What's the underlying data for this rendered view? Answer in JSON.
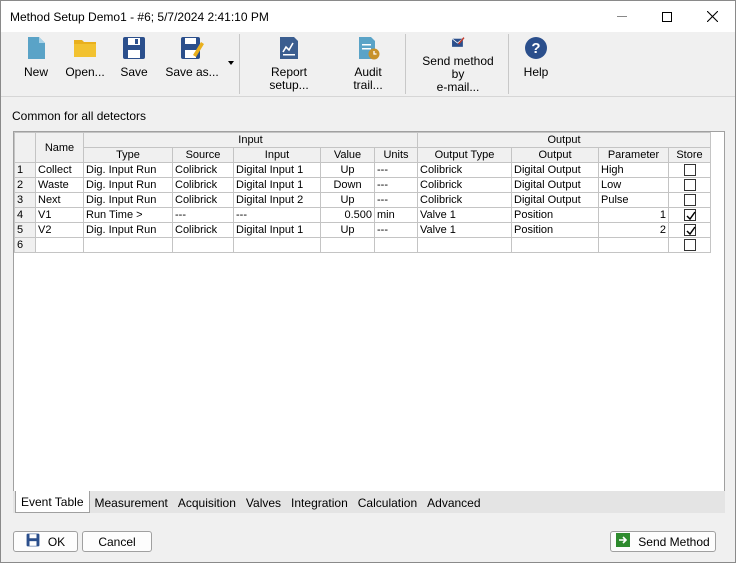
{
  "window": {
    "title": "Method Setup Demo1 - #6;  5/7/2024   2:41:10 PM"
  },
  "toolbar": {
    "new": "New",
    "open": "Open...",
    "save": "Save",
    "save_as": "Save as...",
    "report_setup": "Report setup...",
    "audit_trail": "Audit trail...",
    "send_email_line1": "Send method by",
    "send_email_line2": "e-mail...",
    "help": "Help"
  },
  "section_label": "Common for all detectors",
  "table": {
    "group_headers": {
      "name": "Name",
      "input": "Input",
      "output": "Output"
    },
    "columns": [
      "Type",
      "Source",
      "Input",
      "Value",
      "Units",
      "Output Type",
      "Output",
      "Parameter",
      "Store"
    ],
    "rows": [
      {
        "num": "1",
        "name": "Collect",
        "type": "Dig. Input Run",
        "source": "Colibrick",
        "input": "Digital Input 1",
        "value": "Up",
        "units": "---",
        "output_type": "Colibrick",
        "output": "Digital Output",
        "parameter": "High",
        "store": false
      },
      {
        "num": "2",
        "name": "Waste",
        "type": "Dig. Input Run",
        "source": "Colibrick",
        "input": "Digital Input 1",
        "value": "Down",
        "units": "---",
        "output_type": "Colibrick",
        "output": "Digital Output",
        "parameter": "Low",
        "store": false
      },
      {
        "num": "3",
        "name": "Next",
        "type": "Dig. Input Run",
        "source": "Colibrick",
        "input": "Digital Input 2",
        "value": "Up",
        "units": "---",
        "output_type": "Colibrick",
        "output": "Digital Output",
        "parameter": "Pulse",
        "store": false
      },
      {
        "num": "4",
        "name": "V1",
        "type": "Run Time >",
        "source": "---",
        "input": "---",
        "value": "0.500",
        "units": "min",
        "output_type": "Valve 1",
        "output": "Position",
        "parameter": "1",
        "store": true
      },
      {
        "num": "5",
        "name": "V2",
        "type": "Dig. Input Run",
        "source": "Colibrick",
        "input": "Digital Input 1",
        "value": "Up",
        "units": "---",
        "output_type": "Valve 1",
        "output": "Position",
        "parameter": "2",
        "store": true
      },
      {
        "num": "6",
        "name": "",
        "type": "",
        "source": "",
        "input": "",
        "value": "",
        "units": "",
        "output_type": "",
        "output": "",
        "parameter": "",
        "store": false
      }
    ]
  },
  "tabs": [
    "Event Table",
    "Measurement",
    "Acquisition",
    "Valves",
    "Integration",
    "Calculation",
    "Advanced"
  ],
  "buttons": {
    "ok": "OK",
    "cancel": "Cancel",
    "send_method": "Send Method"
  },
  "colors": {
    "icon_blue": "#2b4f8c",
    "icon_yellow": "#e9b01d",
    "icon_teal": "#5aa3c7",
    "accent_green": "#2e8b2e"
  }
}
